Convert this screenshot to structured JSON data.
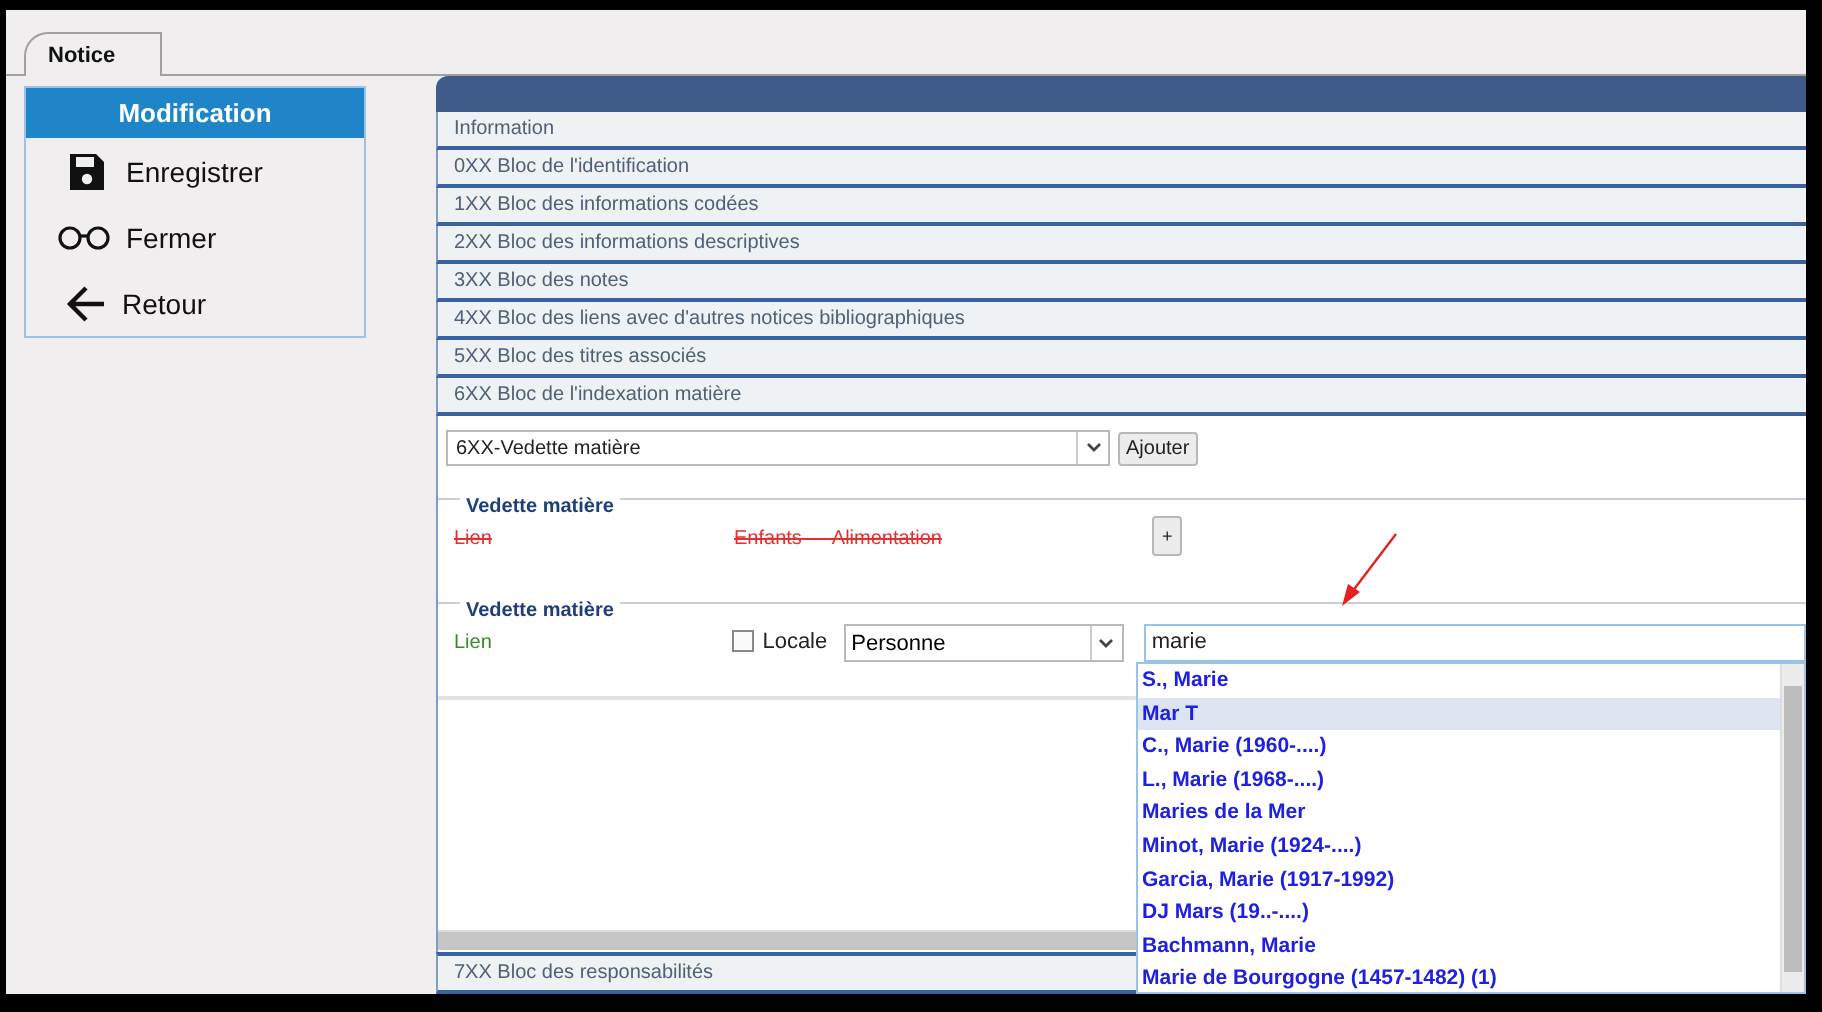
{
  "tabs": [
    {
      "label": "Notice",
      "selected": true
    }
  ],
  "sidebar": {
    "title": "Modification",
    "items": [
      {
        "label": "Enregistrer",
        "kind": "save"
      },
      {
        "label": "Fermer",
        "kind": "glasses"
      },
      {
        "label": "Retour",
        "kind": "back"
      }
    ]
  },
  "sections": [
    {
      "label": "Information"
    },
    {
      "label": "0XX Bloc de l'identification"
    },
    {
      "label": "1XX Bloc des informations codées"
    },
    {
      "label": "2XX Bloc des informations descriptives"
    },
    {
      "label": "3XX Bloc des notes"
    },
    {
      "label": "4XX Bloc des liens avec d'autres notices bibliographiques"
    },
    {
      "label": "5XX Bloc des titres associés"
    },
    {
      "label": "6XX Bloc de l'indexation matière",
      "content": {
        "field_select": {
          "value": "6XX-Vedette matière"
        },
        "add_button": "Ajouter",
        "fieldsets": [
          {
            "legend": "Vedette matière",
            "deleted": true,
            "link": "Lien",
            "value": "Enfants — Alimentation",
            "button": "+"
          },
          {
            "legend": "Vedette matière",
            "deleted": false,
            "link": "Lien",
            "locale": {
              "label": "Locale",
              "checked": false
            },
            "type_select": "Personne",
            "search": {
              "value": "marie"
            }
          }
        ]
      }
    },
    {
      "label": "7XX Bloc des responsabilités"
    }
  ],
  "suggestions": [
    {
      "label": "S., Marie",
      "selected": false
    },
    {
      "label": "Mar T",
      "selected": true
    },
    {
      "label": "C., Marie (1960-....)",
      "selected": false
    },
    {
      "label": "L., Marie (1968-....)",
      "selected": false
    },
    {
      "label": "Maries de la Mer",
      "selected": false
    },
    {
      "label": "Minot, Marie (1924-....)",
      "selected": false
    },
    {
      "label": "Garcia, Marie (1917-1992)",
      "selected": false
    },
    {
      "label": "DJ Mars (19..-....)",
      "selected": false
    },
    {
      "label": "Bachmann, Marie",
      "selected": false
    },
    {
      "label": "Marie de Bourgogne (1457-1482) (1)",
      "selected": false
    }
  ]
}
